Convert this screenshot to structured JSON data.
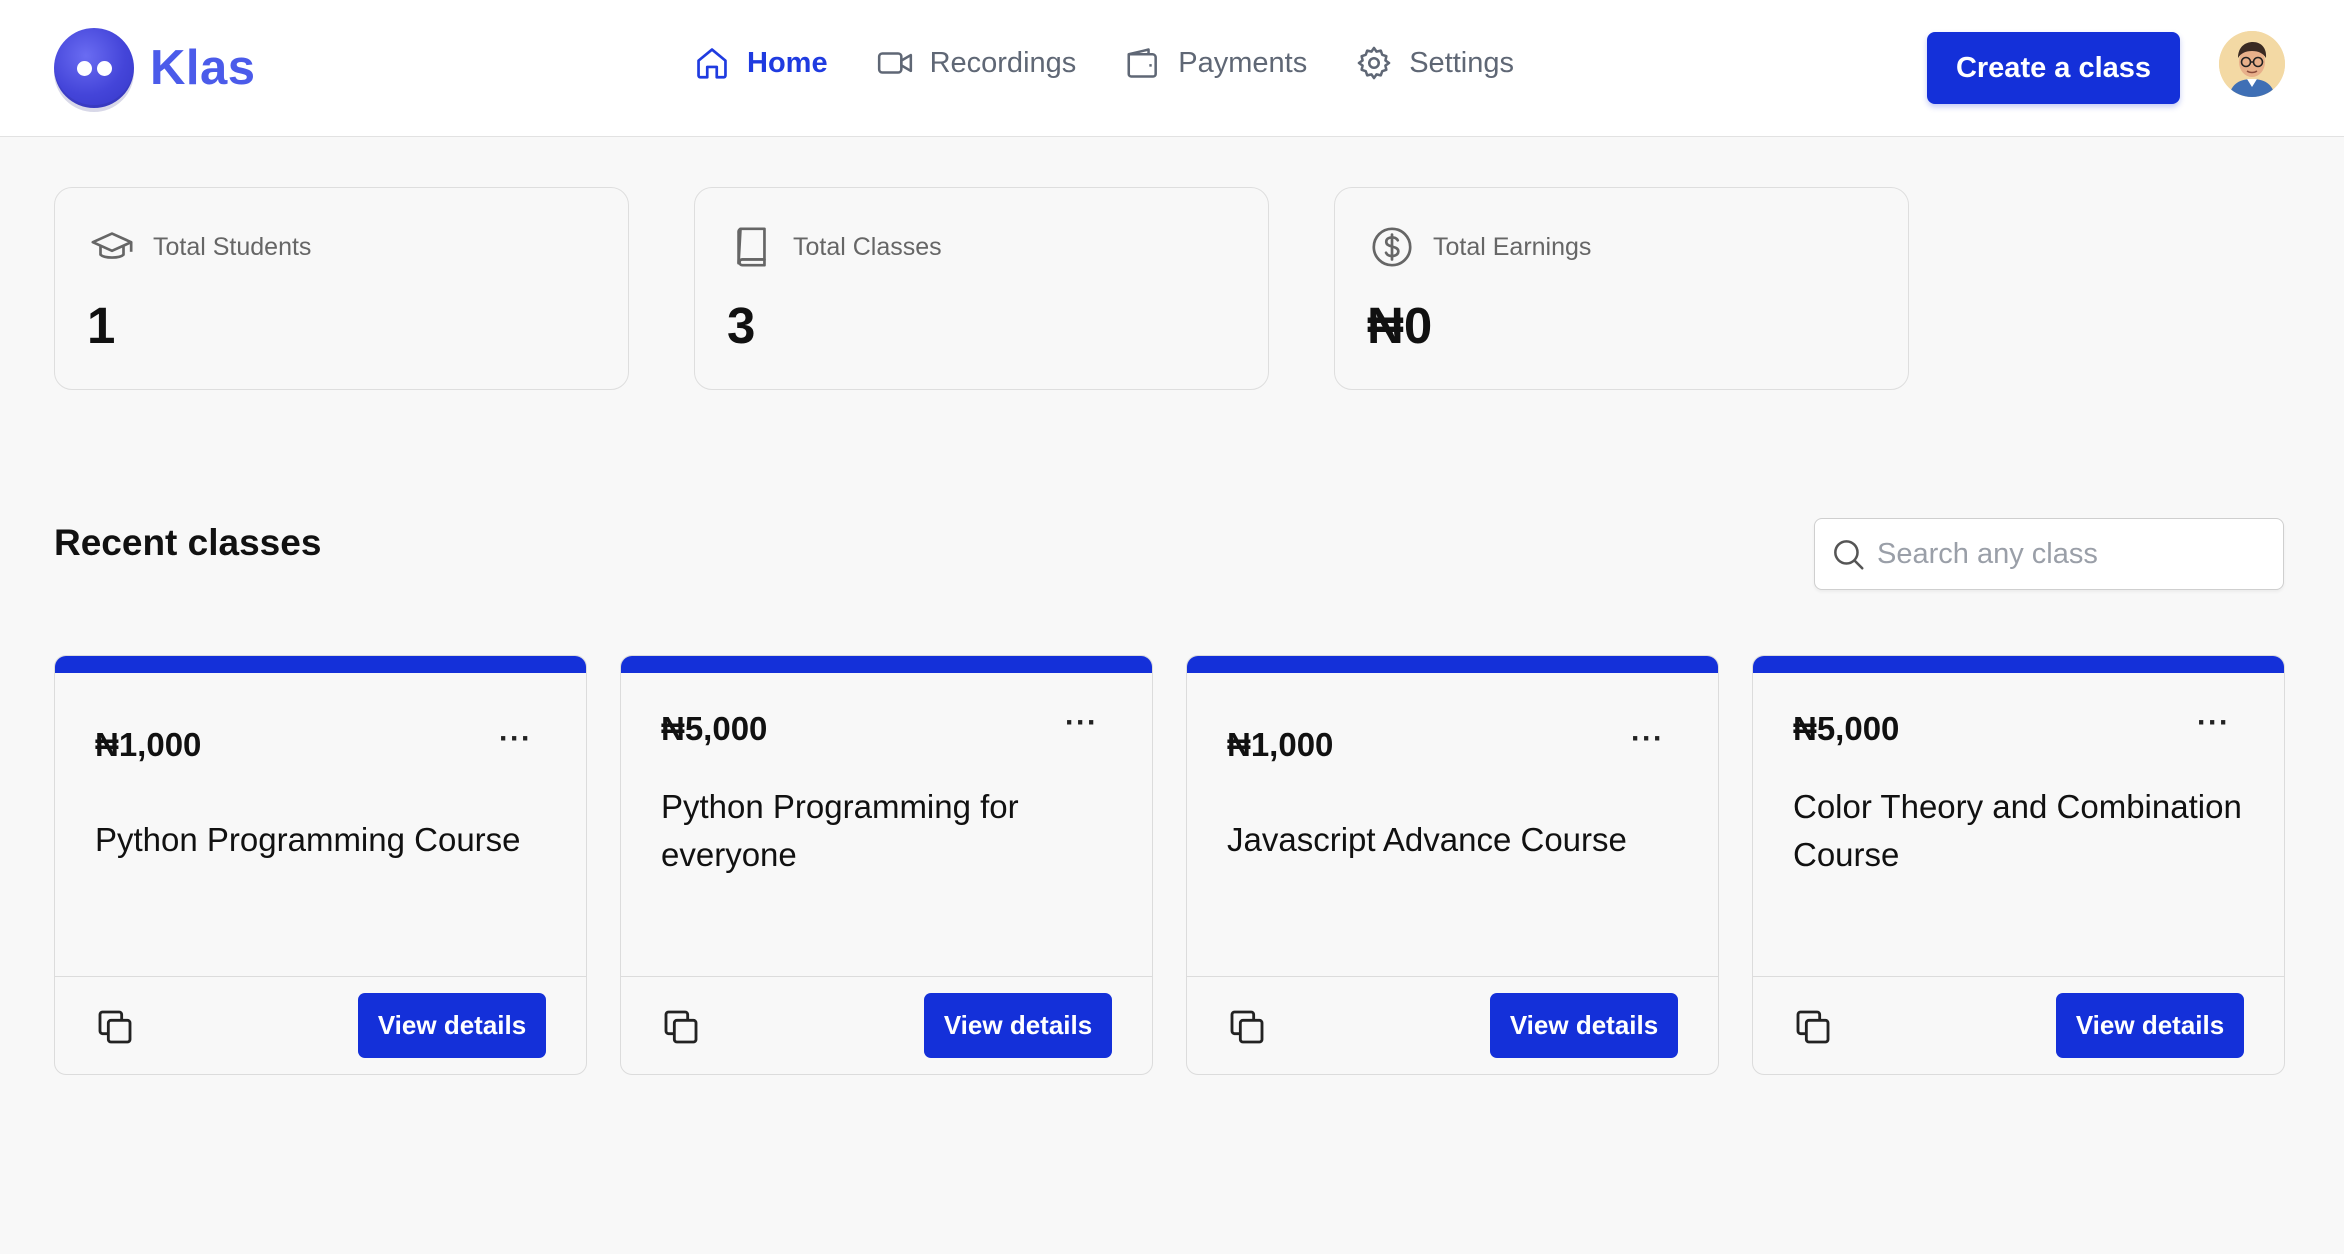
{
  "app": {
    "name": "Klas"
  },
  "nav": {
    "items": [
      {
        "label": "Home",
        "icon": "home-icon",
        "active": true
      },
      {
        "label": "Recordings",
        "icon": "video-icon",
        "active": false
      },
      {
        "label": "Payments",
        "icon": "wallet-icon",
        "active": false
      },
      {
        "label": "Settings",
        "icon": "gear-icon",
        "active": false
      }
    ]
  },
  "header": {
    "create_label": "Create a class"
  },
  "stats": [
    {
      "label": "Total Students",
      "value": "1",
      "icon": "graduation-cap-icon"
    },
    {
      "label": "Total Classes",
      "value": "3",
      "icon": "book-icon"
    },
    {
      "label": "Total Earnings",
      "value": "₦0",
      "icon": "dollar-circle-icon"
    }
  ],
  "recent": {
    "title": "Recent classes",
    "search_placeholder": "Search any class"
  },
  "classes": [
    {
      "price": "₦1,000",
      "title": "Python Programming Course",
      "menu": "···",
      "button": "View details"
    },
    {
      "price": "₦5,000",
      "title": "Python Programming for everyone",
      "menu": "···",
      "button": "View details"
    },
    {
      "price": "₦1,000",
      "title": "Javascript Advance Course",
      "menu": "···",
      "button": "View details"
    },
    {
      "price": "₦5,000",
      "title": "Color Theory and Combination Course",
      "menu": "···",
      "button": "View details"
    }
  ],
  "colors": {
    "accent": "#1430d9",
    "logo": "#4b5bea",
    "background": "#f8f8f8"
  }
}
